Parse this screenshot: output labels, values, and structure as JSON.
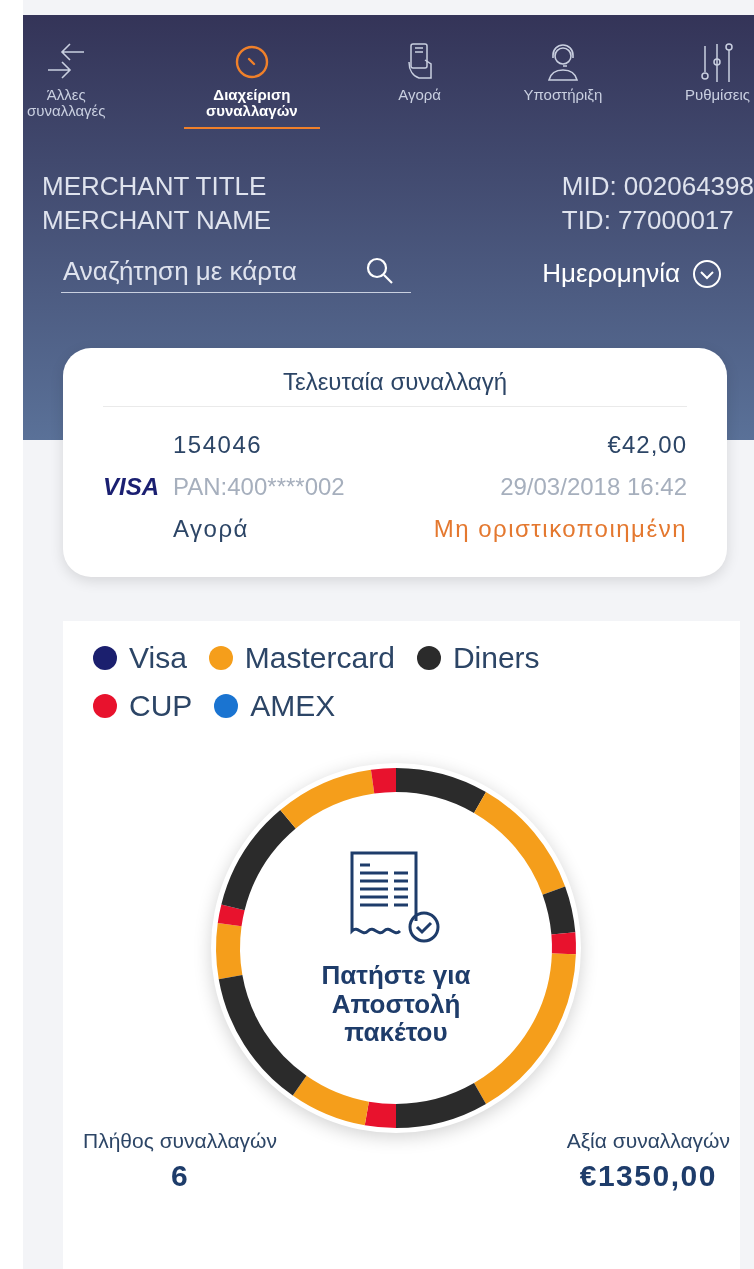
{
  "nav": [
    {
      "label": "Άλλες\nσυναλλαγές",
      "selected": false
    },
    {
      "label": "Διαχείριση\nσυναλλαγών",
      "selected": true
    },
    {
      "label": "Αγορά",
      "selected": false
    },
    {
      "label": "Υποστήριξη",
      "selected": false
    },
    {
      "label": "Ρυθμίσεις",
      "selected": false
    }
  ],
  "merchant": {
    "title": "MERCHANT TITLE",
    "name": "MERCHANT NAME",
    "mid": "MID: 002064398",
    "tid": "TID: 77000017"
  },
  "search": {
    "placeholder": "Αναζήτηση με κάρτα"
  },
  "date_filter": {
    "label": "Ημερομηνία"
  },
  "last_transaction": {
    "heading": "Τελευταία συναλλαγή",
    "card_brand": "VISA",
    "id": "154046",
    "amount": "€42,00",
    "pan": "PAN:400****002",
    "datetime": "29/03/2018 16:42",
    "type": "Αγορά",
    "status": "Μη οριστικοποιημένη"
  },
  "legend": [
    {
      "label": "Visa",
      "color": "#1b1f6e"
    },
    {
      "label": "Mastercard",
      "color": "#f59e1b"
    },
    {
      "label": "Diners",
      "color": "#2b2b2b"
    },
    {
      "label": "CUP",
      "color": "#e8122d"
    },
    {
      "label": "AMEX",
      "color": "#1a74d1"
    }
  ],
  "send_batch": {
    "label": "Πατήστε για\nΑποστολή\nπακέτου"
  },
  "totals": {
    "count_label": "Πλήθος συναλλαγών",
    "count": "6",
    "value_label": "Αξία συναλλαγών",
    "value": "€1350,00"
  }
}
